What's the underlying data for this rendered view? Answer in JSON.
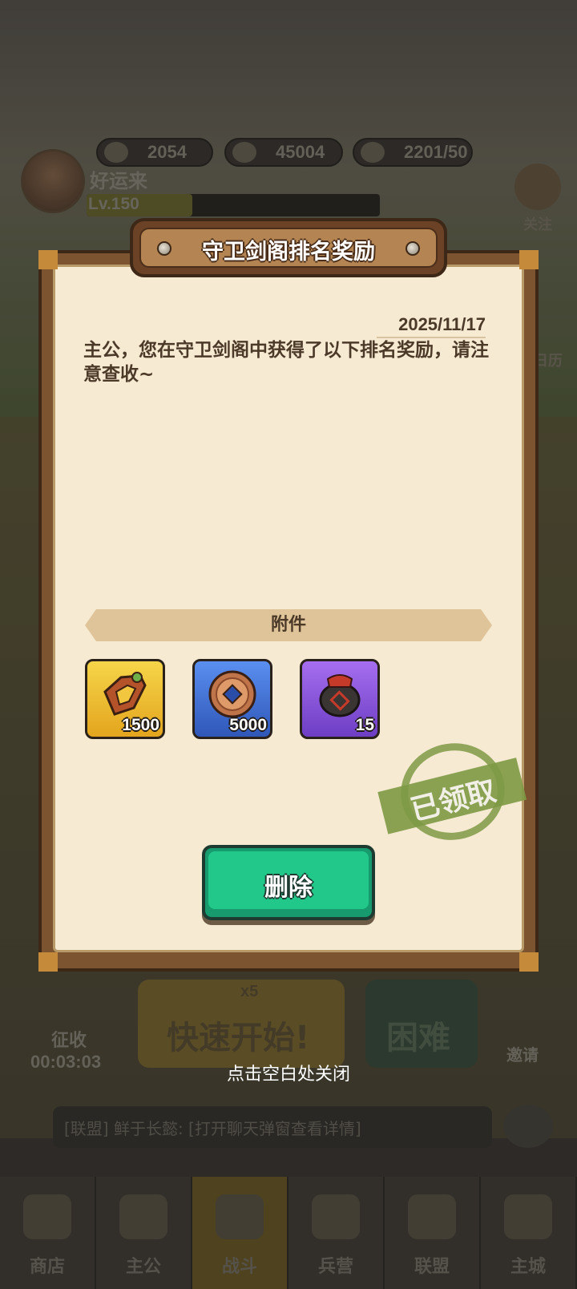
{
  "background": {
    "resources": [
      {
        "icon": "gold-ingot-icon",
        "value": "2054"
      },
      {
        "icon": "coin-icon",
        "value": "45004"
      },
      {
        "icon": "food-icon",
        "value": "2201/50"
      }
    ],
    "player": {
      "name": "好运来",
      "level": "Lv.150",
      "level_progress": 0.36
    },
    "side_right": [
      "关注",
      "日历"
    ],
    "actions": {
      "quick_start": "快速开始!",
      "quick_cost": "x5",
      "hard": "困难"
    },
    "collect": {
      "label": "征收",
      "timer": "00:03:03"
    },
    "invite": "邀请",
    "chat": "[联盟] 鲜于长懿: [打开聊天弹窗查看详情]",
    "nav": [
      "商店",
      "主公",
      "战斗",
      "兵营",
      "联盟",
      "主城"
    ]
  },
  "modal": {
    "title": "守卫剑阁排名奖励",
    "date": "2025/11/17",
    "body": "主公，您在守卫剑阁中获得了以下排名奖励，请注意查收~",
    "attachments_label": "附件",
    "items": [
      {
        "icon": "jade-ornament-icon",
        "count": "1500",
        "color": "#f0c33a"
      },
      {
        "icon": "copper-coin-icon",
        "count": "5000",
        "color": "#4173d8"
      },
      {
        "icon": "wine-jar-icon",
        "count": "15",
        "color": "#8d54dc"
      }
    ],
    "stamp": "已领取",
    "delete_label": "删除"
  },
  "close_hint": "点击空白处关闭"
}
